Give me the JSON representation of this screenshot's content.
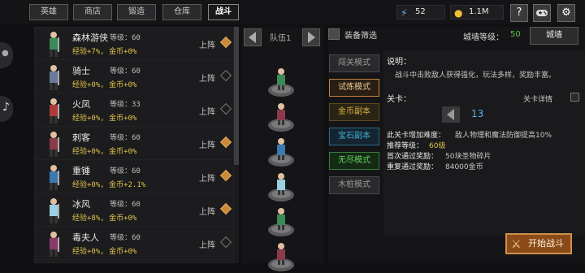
{
  "tabs": [
    {
      "label": "英雄",
      "active": false
    },
    {
      "label": "商店",
      "active": false
    },
    {
      "label": "锻造",
      "active": false
    },
    {
      "label": "仓库",
      "active": false
    },
    {
      "label": "战斗",
      "active": true
    }
  ],
  "resources": {
    "energy": {
      "icon": "lightning-icon",
      "value": "52"
    },
    "gold": {
      "icon": "gold-coin-icon",
      "value": "1.1M"
    }
  },
  "top_buttons": [
    "help-icon",
    "gamepad-icon",
    "settings-icon"
  ],
  "heroes": [
    {
      "name": "森林游侠",
      "level": "等级：60",
      "bonus": "经验+7%, 金币+0%",
      "deploy_label": "上阵",
      "deployed": true,
      "color": "#3a8a5a"
    },
    {
      "name": "骑士",
      "level": "等级：60",
      "bonus": "经验+0%, 金币+0%",
      "deploy_label": "上阵",
      "deployed": false,
      "color": "#6a7a9a"
    },
    {
      "name": "火凤",
      "level": "等级：33",
      "bonus": "经验+0%, 金币+0%",
      "deploy_label": "上阵",
      "deployed": false,
      "color": "#b03a3a"
    },
    {
      "name": "刺客",
      "level": "等级：60",
      "bonus": "经验+0%, 金币+0%",
      "deploy_label": "上阵",
      "deployed": true,
      "color": "#8a3a4a"
    },
    {
      "name": "重锤",
      "level": "等级：60",
      "bonus": "经验+0%, 金币+2.1%",
      "deploy_label": "上阵",
      "deployed": true,
      "color": "#3a7ab0"
    },
    {
      "name": "冰风",
      "level": "等级：60",
      "bonus": "经验+8%, 金币+0%",
      "deploy_label": "上阵",
      "deployed": true,
      "color": "#9ad0e0"
    },
    {
      "name": "毒夫人",
      "level": "等级：60",
      "bonus": "经验+0%, 金币+0%",
      "deploy_label": "上阵",
      "deployed": false,
      "color": "#8a3a6a"
    }
  ],
  "team": {
    "name": "队伍1"
  },
  "filter": {
    "title": "装备筛选"
  },
  "wall": {
    "label": "城墙等级：",
    "level": "50",
    "button": "城墙"
  },
  "modes": [
    {
      "label": "闯关模式",
      "text": "#9a9a9a",
      "bg": "#2a2a2c",
      "border": "#4a4a4c"
    },
    {
      "label": "试炼模式",
      "text": "#e8c890",
      "bg": "#2a1e14",
      "border": "#c08040"
    },
    {
      "label": "金币副本",
      "text": "#d8b040",
      "bg": "#2a2414",
      "border": "#5a4a20"
    },
    {
      "label": "宝石副本",
      "text": "#40b0d8",
      "bg": "#142430",
      "border": "#2a6a8a"
    },
    {
      "label": "无尽模式",
      "text": "#60d060",
      "bg": "#142a14",
      "border": "#3a7a3a"
    },
    {
      "label": "木桩模式",
      "text": "#9a9a9a",
      "bg": "#2a2a2c",
      "border": "#4a4a4c"
    }
  ],
  "info": {
    "desc_title": "说明：",
    "desc": "战斗中击败敌人获得强化，玩法多样，奖励丰富。",
    "stage_label": "关卡：",
    "stage_detail": "关卡详情",
    "stage": "13",
    "difficulty_label": "此关卡增加难度：",
    "difficulty_value": "敌人物理和魔法防御提高10%",
    "rec_label": "推荐等级：",
    "rec_value": "60级",
    "first_label": "首次通过奖励：",
    "first_value": "50块圣物碎片",
    "repeat_label": "重复通过奖励：",
    "repeat_value": "84000金币"
  },
  "start_button": "开始战斗"
}
